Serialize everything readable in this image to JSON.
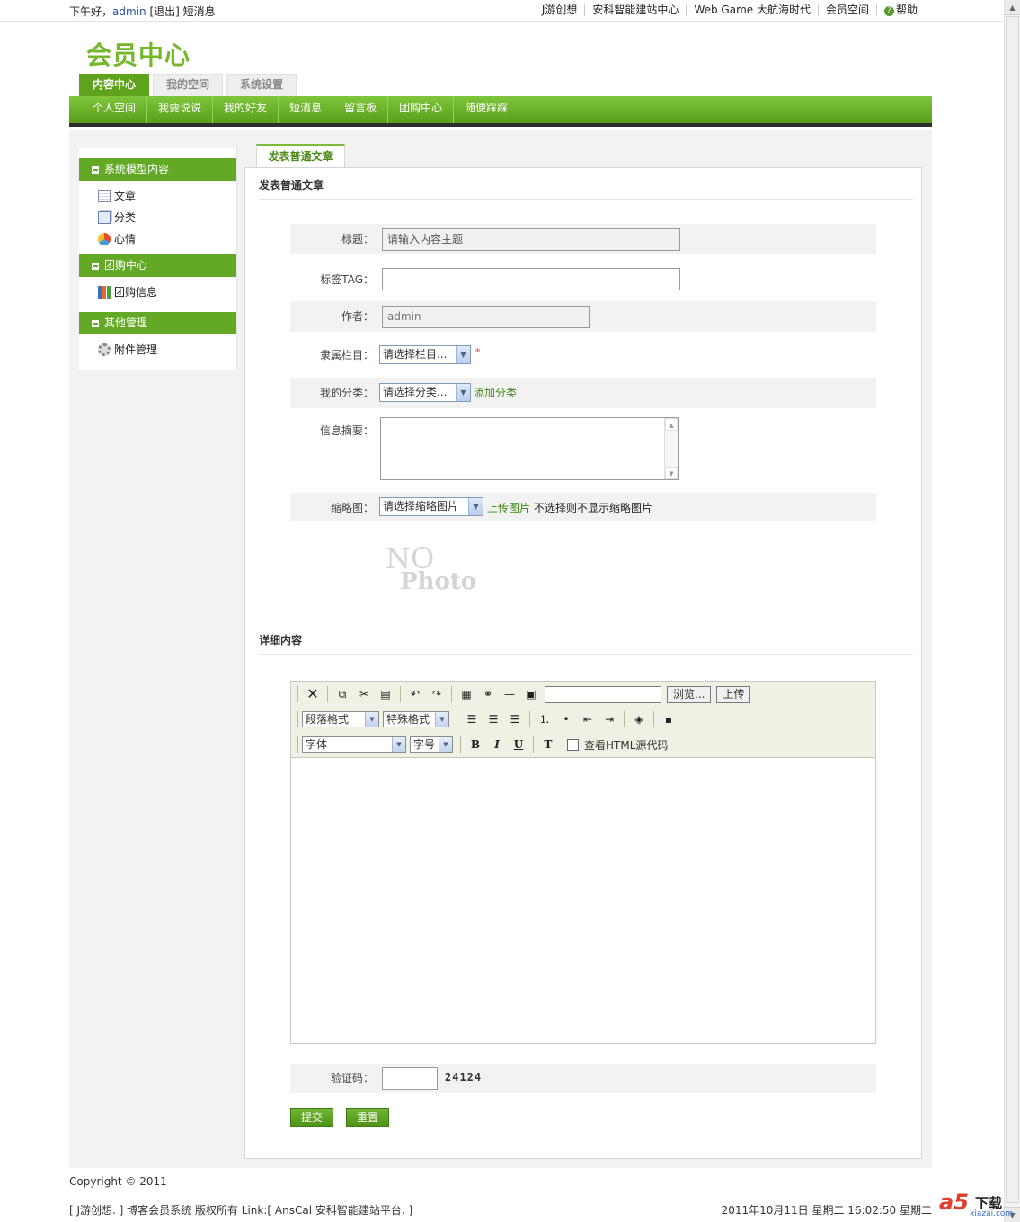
{
  "topbar": {
    "greeting": "下午好，",
    "username": "admin",
    "logout": "[退出]",
    "messages": "短消息",
    "links": [
      "J游创想",
      "安科智能建站中心",
      "Web Game 大航海时代",
      "会员空间"
    ],
    "help": "帮助"
  },
  "header": {
    "logo": "会员中心",
    "tabs": [
      "内容中心",
      "我的空间",
      "系统设置"
    ],
    "nav": [
      "个人空间",
      "我要说说",
      "我的好友",
      "短消息",
      "留言板",
      "团购中心",
      "随便踩踩"
    ]
  },
  "sidebar": {
    "groups": [
      {
        "title": "系统模型内容",
        "items": [
          {
            "label": "文章",
            "icon": "document-icon"
          },
          {
            "label": "分类",
            "icon": "category-icon"
          },
          {
            "label": "心情",
            "icon": "mood-icon"
          }
        ]
      },
      {
        "title": "团购中心",
        "items": [
          {
            "label": "团购信息",
            "icon": "bar-chart-icon"
          }
        ]
      },
      {
        "title": "其他管理",
        "items": [
          {
            "label": "附件管理",
            "icon": "gear-icon"
          }
        ]
      }
    ]
  },
  "panel": {
    "tab": "发表普通文章",
    "section1": "发表普通文章",
    "section2": "详细内容"
  },
  "form": {
    "title_label": "标题：",
    "title_value": "请输入内容主题",
    "tag_label": "标签TAG：",
    "author_label": "作者：",
    "author_value": "admin",
    "column_label": "隶属栏目：",
    "column_select": "请选择栏目...",
    "column_required": "*",
    "category_label": "我的分类：",
    "category_select": "请选择分类...",
    "add_category": "添加分类",
    "summary_label": "信息摘要：",
    "thumb_label": "缩略图：",
    "thumb_select": "请选择缩略图片",
    "upload_image": "上传图片",
    "thumb_hint": "不选择则不显示缩略图片",
    "nophoto_1": "NO",
    "nophoto_2": "Photo"
  },
  "editor": {
    "browse": "浏览...",
    "upload": "上传",
    "paragraph": "段落格式",
    "special": "特殊格式",
    "font": "字体",
    "size": "字号",
    "bold": "B",
    "italic": "I",
    "underline": "U",
    "view_html": "查看HTML源代码"
  },
  "captcha": {
    "label": "验证码：",
    "code": "24124"
  },
  "buttons": {
    "submit": "提交",
    "reset": "重置"
  },
  "footer": {
    "copyright": "Copyright © 2011",
    "credits": "[ J游创想. ] 博客会员系统 版权所有 Link:[ AnsCal 安科智能建站平台. ]",
    "datetime": "2011年10月11日 星期二 16:02:50 星期二"
  },
  "brand": {
    "logo": "a5",
    "download": "下载",
    "site": "xiazai.com"
  },
  "colors": {
    "accent": "#63a925",
    "nav_dark": "#2d2d2d",
    "link_blue": "#2b55a3"
  }
}
